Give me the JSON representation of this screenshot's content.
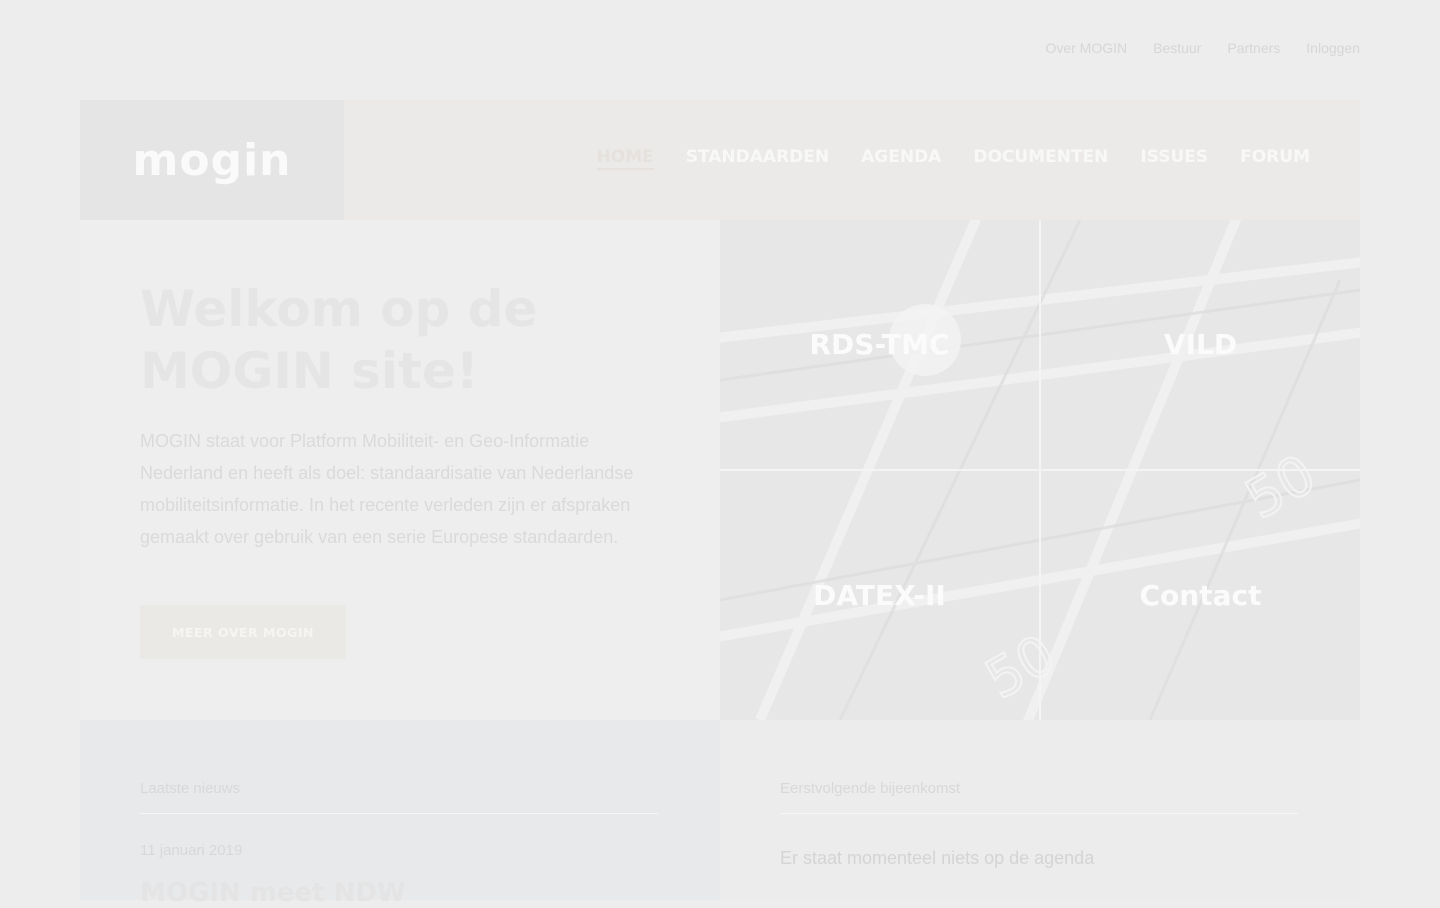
{
  "top_nav": {
    "items": [
      "Over MOGIN",
      "Bestuur",
      "Partners",
      "Inloggen"
    ]
  },
  "header": {
    "logo_text": "mogin",
    "nav": [
      {
        "label": "HOME",
        "active": true
      },
      {
        "label": "STANDAARDEN",
        "active": false
      },
      {
        "label": "AGENDA",
        "active": false
      },
      {
        "label": "DOCUMENTEN",
        "active": false
      },
      {
        "label": "ISSUES",
        "active": false
      },
      {
        "label": "FORUM",
        "active": false
      }
    ]
  },
  "hero": {
    "title": "Welkom op de MOGIN site!",
    "text": "MOGIN staat voor Platform Mobiliteit- en Geo-Informatie Nederland en heeft als doel: standaardisatie van Nederlandse mobiliteitsinformatie. In het recente verleden zijn er afspraken gemaakt over gebruik van een serie Europese standaarden.",
    "button": "MEER OVER MOGIN"
  },
  "tiles": [
    {
      "label": "RDS-TMC"
    },
    {
      "label": "VILD"
    },
    {
      "label": "DATEX-II"
    },
    {
      "label": "Contact"
    }
  ],
  "news": {
    "heading": "Laatste nieuws",
    "date": "11 januari 2019",
    "title": "MOGIN meet NDW"
  },
  "events": {
    "heading": "Eerstvolgende bijeenkomst",
    "empty_message": "Er staat momenteel niets op de agenda"
  },
  "colors": {
    "background": "#ededed",
    "header_bar": "#ebeae8",
    "logo_box": "#e5e5e5",
    "news_panel": "#e8e9eb",
    "button": "#ebe9e5"
  }
}
